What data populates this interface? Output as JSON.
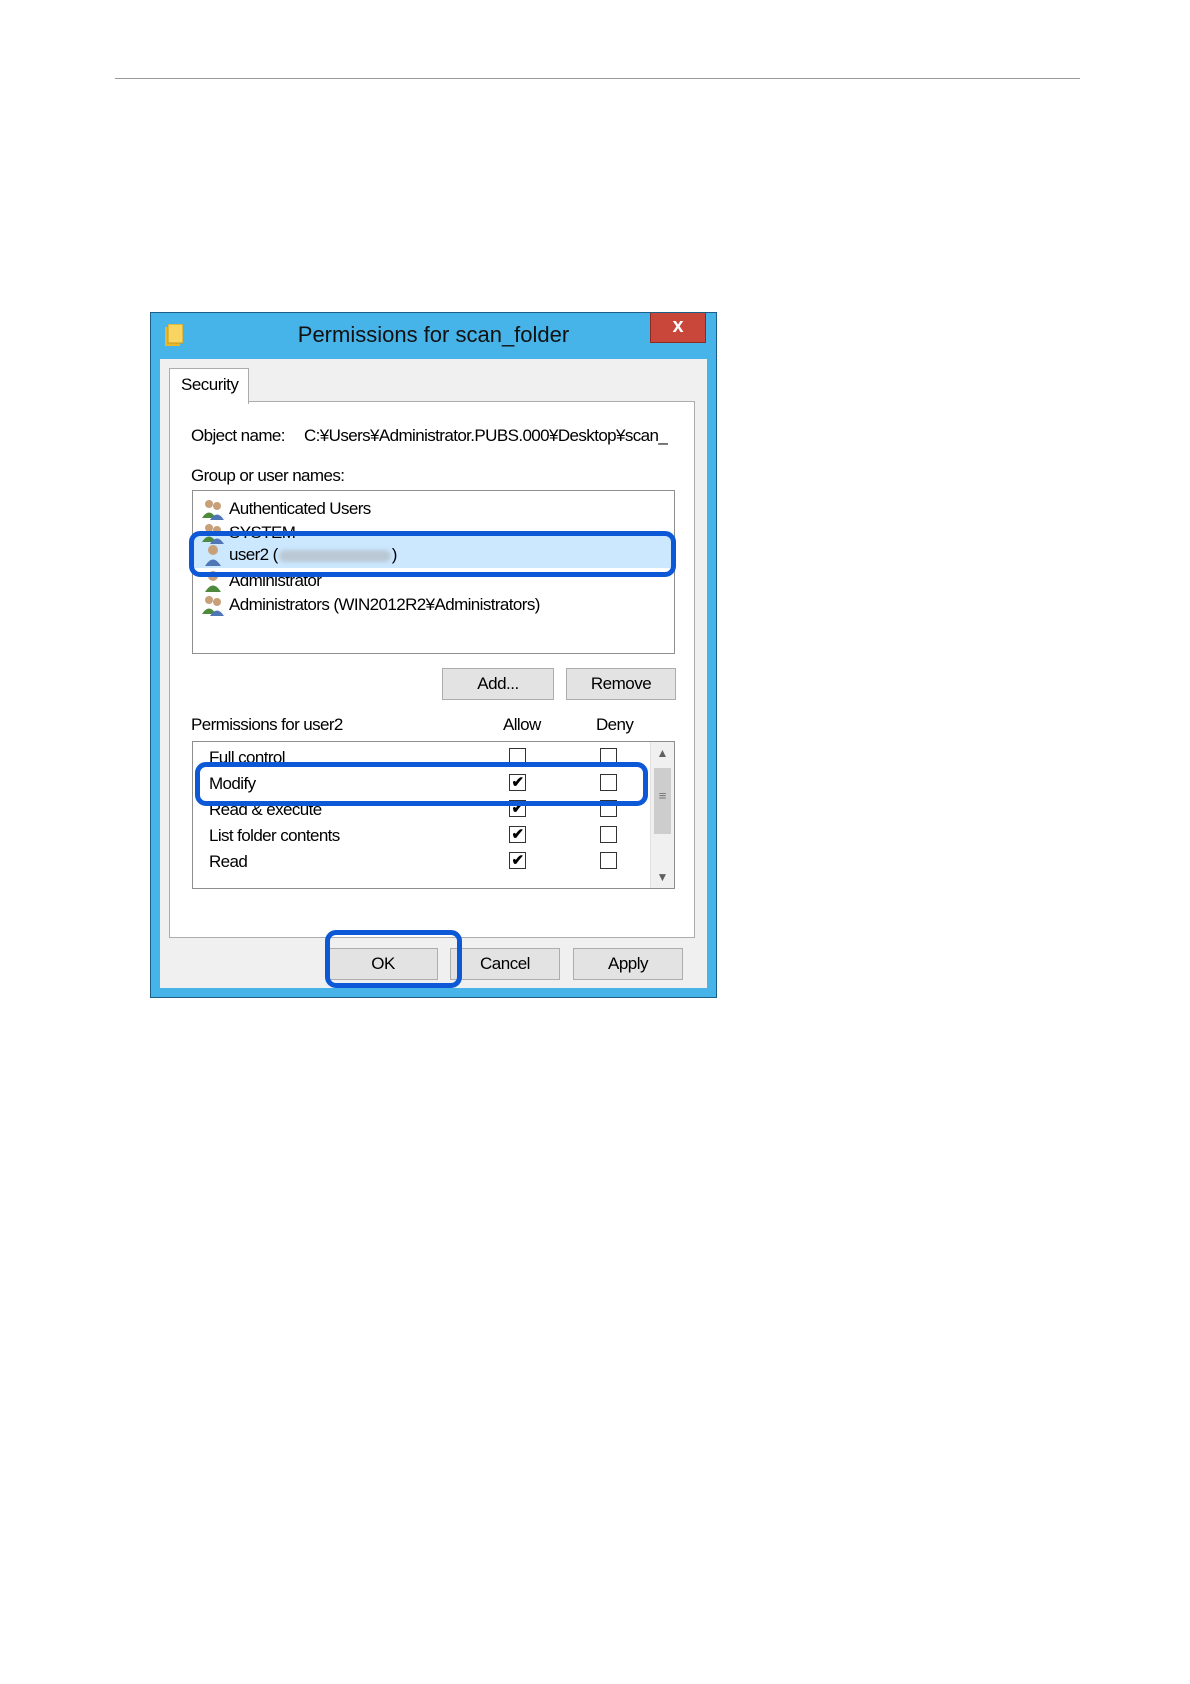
{
  "dialog": {
    "title": "Permissions for scan_folder",
    "close_label": "x",
    "tab_label": "Security",
    "object_name_label": "Object name:",
    "object_name_value": "C:¥Users¥Administrator.PUBS.000¥Desktop¥scan_",
    "group_label": "Group or user names:",
    "users": [
      {
        "name": "Authenticated Users",
        "icon": "group-icon"
      },
      {
        "name": "SYSTEM",
        "icon": "group-icon"
      },
      {
        "name_prefix": "user2 (",
        "name_suffix": ")",
        "icon": "user-icon",
        "selected": true
      },
      {
        "name": "Administrator",
        "icon": "user-icon"
      },
      {
        "name": "Administrators (WIN2012R2¥Administrators)",
        "icon": "group-icon"
      }
    ],
    "add_label": "Add...",
    "remove_label": "Remove",
    "permissions_label": "Permissions for user2",
    "allow_header": "Allow",
    "deny_header": "Deny",
    "permissions": [
      {
        "name": "Full control",
        "allow": false,
        "deny": false
      },
      {
        "name": "Modify",
        "allow": true,
        "deny": false
      },
      {
        "name": "Read & execute",
        "allow": true,
        "deny": false
      },
      {
        "name": "List folder contents",
        "allow": true,
        "deny": false
      },
      {
        "name": "Read",
        "allow": true,
        "deny": false
      }
    ],
    "ok_label": "OK",
    "cancel_label": "Cancel",
    "apply_label": "Apply"
  },
  "colors": {
    "window_border": "#46b4e8",
    "highlight": "#0c58d6",
    "close_button": "#c9463a"
  }
}
